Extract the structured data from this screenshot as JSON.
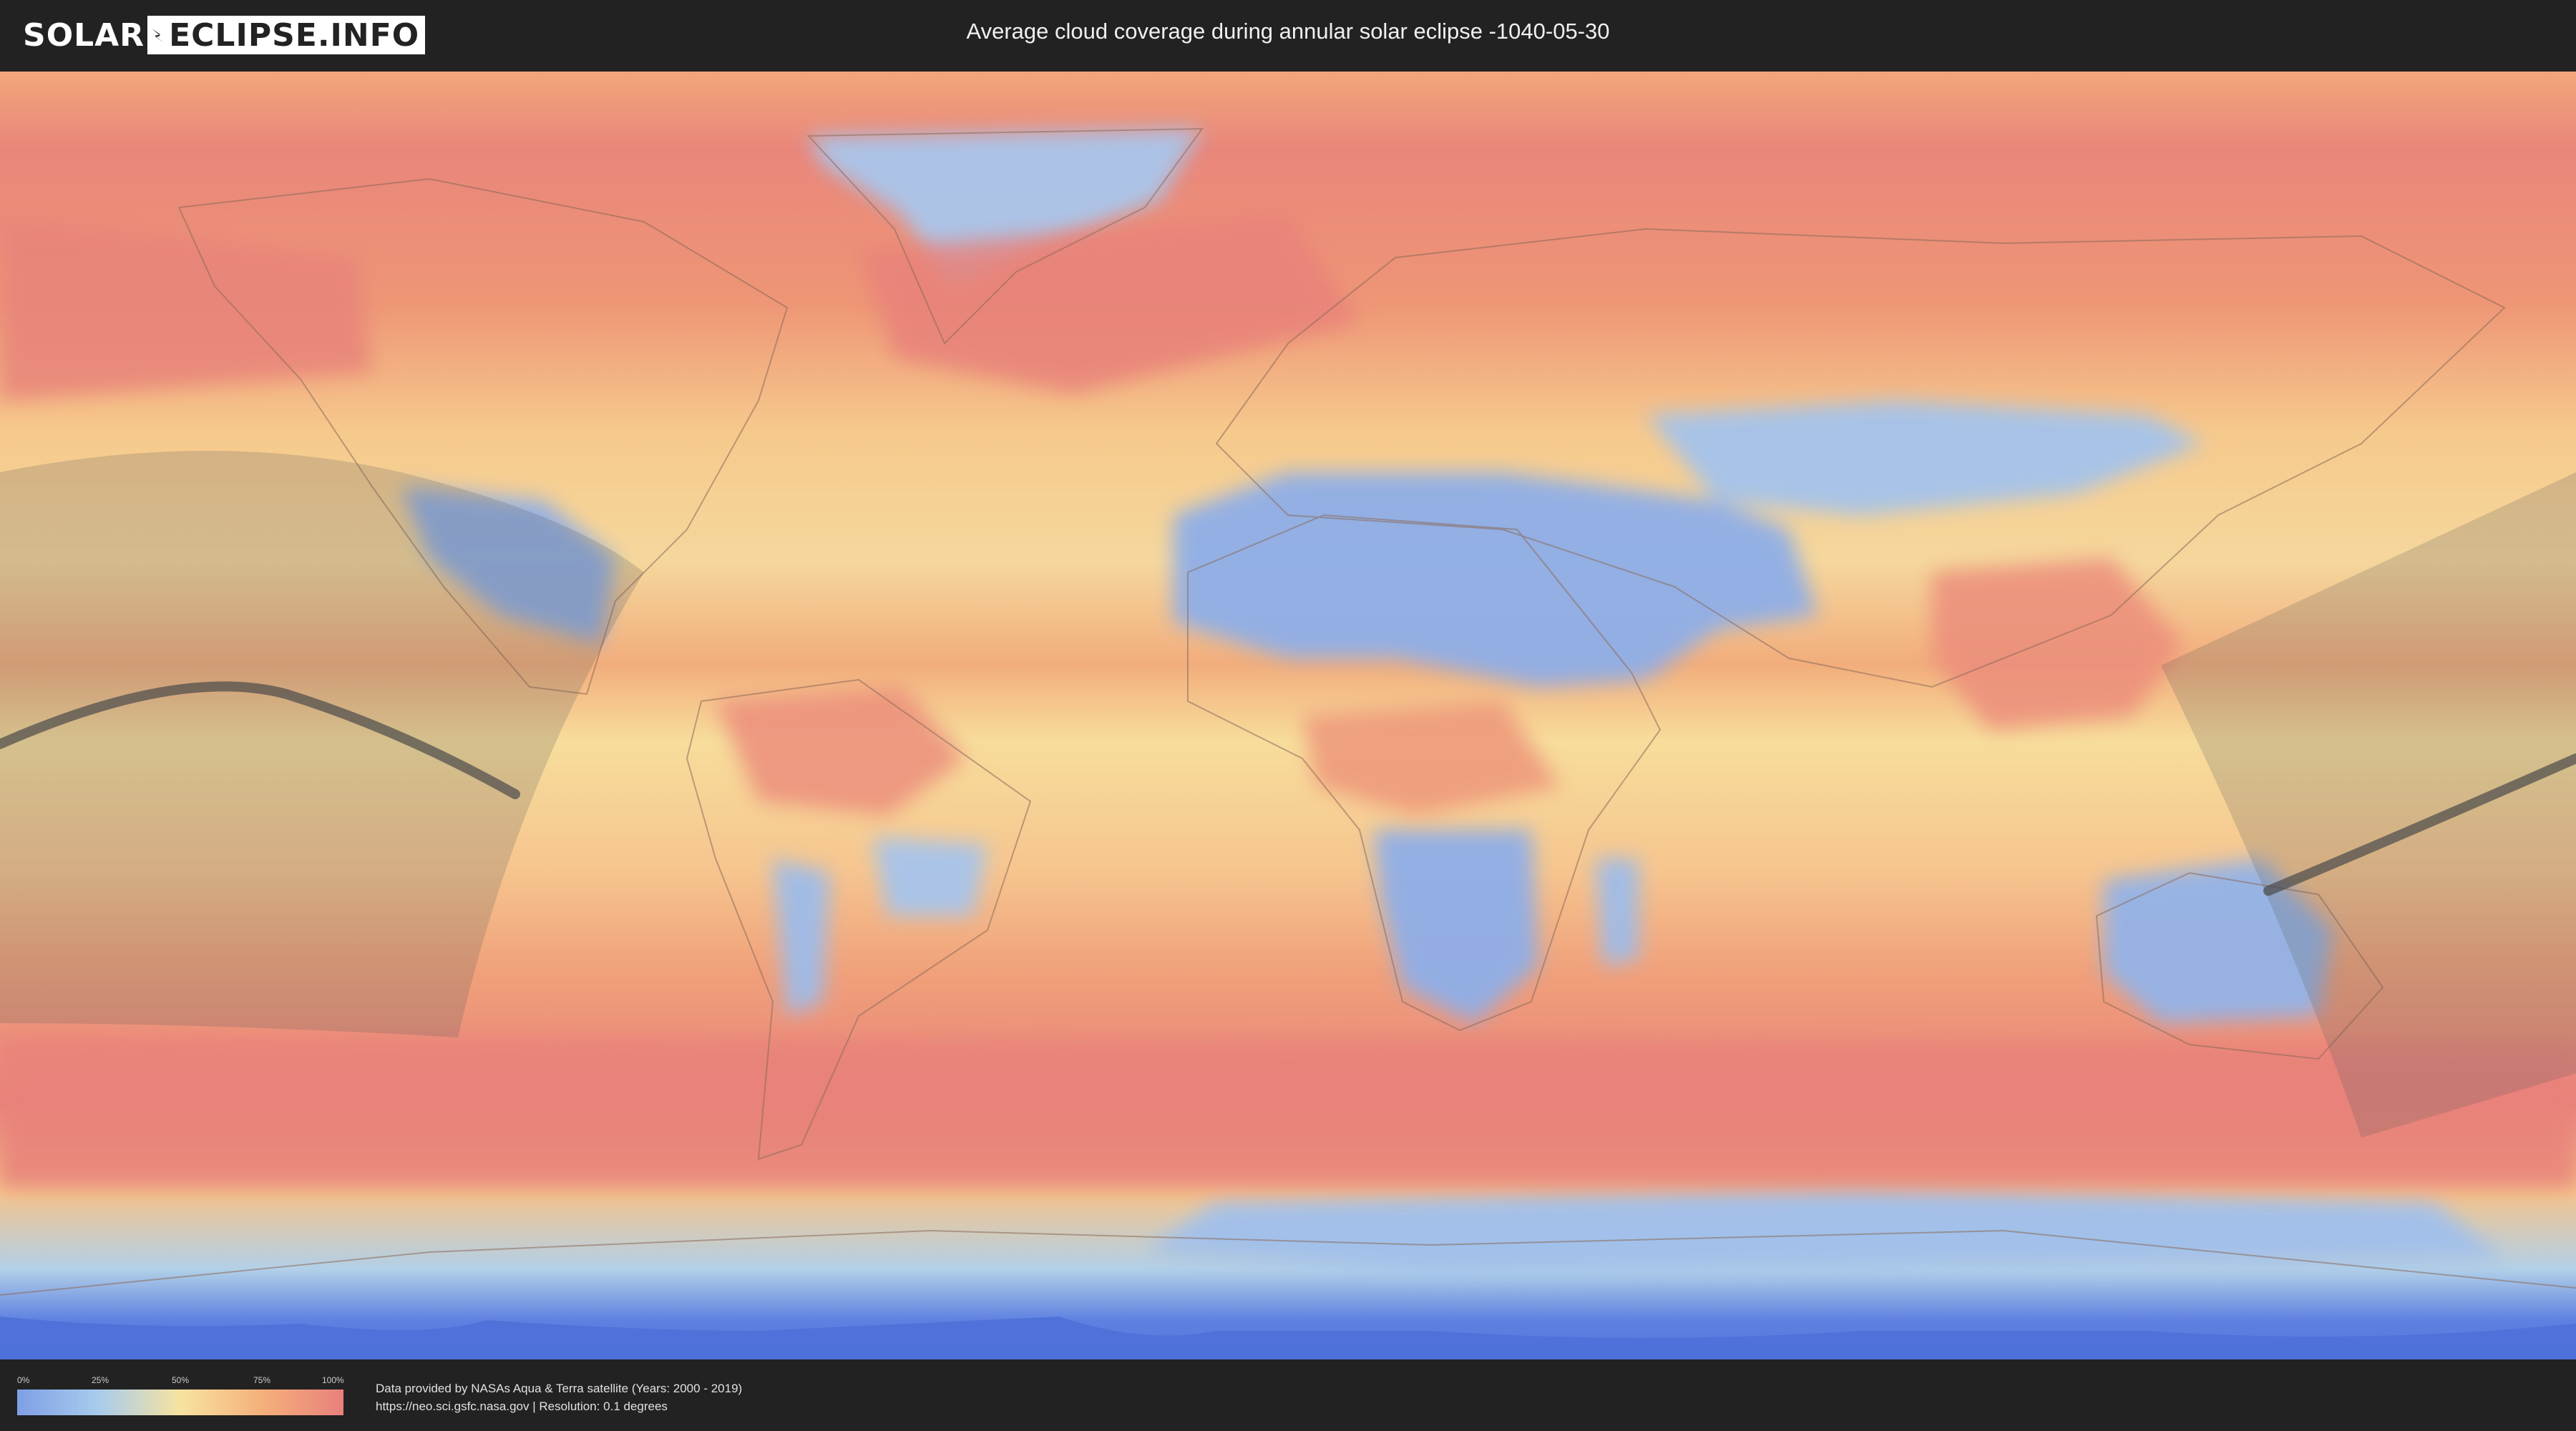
{
  "header": {
    "logo_left": "SOLAR",
    "logo_right": "ECLIPSE.INFO",
    "title": "Average cloud coverage during annular solar eclipse -1040-05-30"
  },
  "map": {
    "type": "cloud-coverage world map",
    "projection": "equirectangular",
    "colors": {
      "clear": "#7f9fe6",
      "low": "#a8ccec",
      "mid": "#f7e3a0",
      "high": "#f5b07a",
      "overcast": "#e9807c",
      "eclipse_path": "#4a4a4a"
    }
  },
  "legend": {
    "ticks": [
      "0%",
      "25%",
      "50%",
      "75%",
      "100%"
    ]
  },
  "footer": {
    "line1": "Data provided by NASAs Aqua & Terra satellite (Years: 2000 - 2019)",
    "line2": "https://neo.sci.gsfc.nasa.gov | Resolution: 0.1 degrees"
  }
}
